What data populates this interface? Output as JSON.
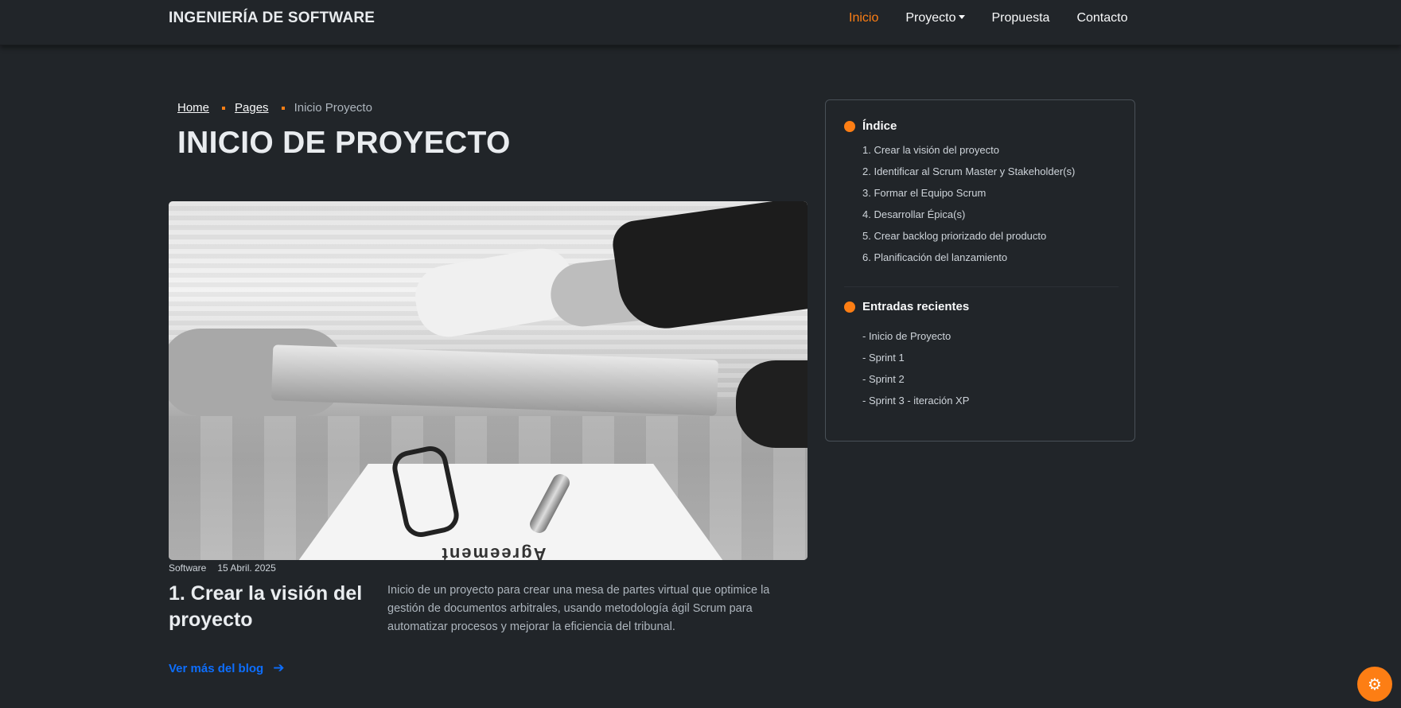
{
  "navbar": {
    "brand": "INGENIERÍA DE SOFTWARE",
    "items": [
      {
        "label": "Inicio",
        "active": true
      },
      {
        "label": "Proyecto",
        "dropdown": true
      },
      {
        "label": "Propuesta"
      },
      {
        "label": "Contacto"
      }
    ]
  },
  "breadcrumb": {
    "items": [
      "Home",
      "Pages"
    ],
    "current": "Inicio Proyecto"
  },
  "page_title": "INICIO DE PROYECTO",
  "hero": {
    "paper_text": "Agreement"
  },
  "post": {
    "category": "Software",
    "date": "15 Abril. 2025",
    "title": "1. Crear la visión del proyecto",
    "excerpt": "Inicio de un proyecto para crear una mesa de partes virtual que optimice la gestión de documentos arbitrales, usando metodología ágil Scrum para automatizar procesos y mejorar la eficiencia del tribunal.",
    "read_more": "Ver más del blog"
  },
  "sidebar": {
    "index_title": "Índice",
    "index_items": [
      "1. Crear la visión del proyecto",
      "2. Identificar al Scrum Master y Stakeholder(s)",
      "3. Formar el Equipo Scrum",
      "4. Desarrollar Épica(s)",
      "5. Crear backlog priorizado del producto",
      "6. Planificación del lanzamiento"
    ],
    "recent_title": "Entradas recientes",
    "recent_items": [
      "- Inicio de Proyecto",
      "- Sprint 1",
      "- Sprint 2",
      "- Sprint 3 - iteración XP"
    ]
  },
  "colors": {
    "background": "#212529",
    "accent": "#fd7e14",
    "link": "#0d6efd"
  },
  "icons": {
    "fab": "gear-icon",
    "read_more": "arrow-right-icon"
  }
}
